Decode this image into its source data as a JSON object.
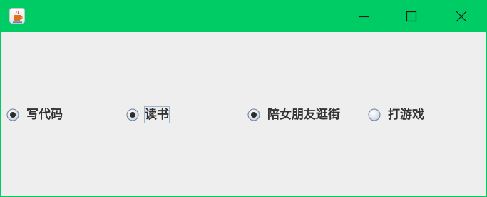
{
  "window": {
    "title": "",
    "titlebar_color": "#00cc66",
    "background_color": "#eeeeee",
    "app_icon": "java-coffee-cup-icon",
    "controls": {
      "minimize_icon": "minimize-icon",
      "maximize_icon": "maximize-icon",
      "close_icon": "close-icon"
    }
  },
  "radios": [
    {
      "label": "写代码",
      "checked": true,
      "focused": false
    },
    {
      "label": "读书",
      "checked": true,
      "focused": true
    },
    {
      "label": "陪女朋友逛街",
      "checked": true,
      "focused": false
    },
    {
      "label": "打游戏",
      "checked": false,
      "focused": false
    }
  ]
}
